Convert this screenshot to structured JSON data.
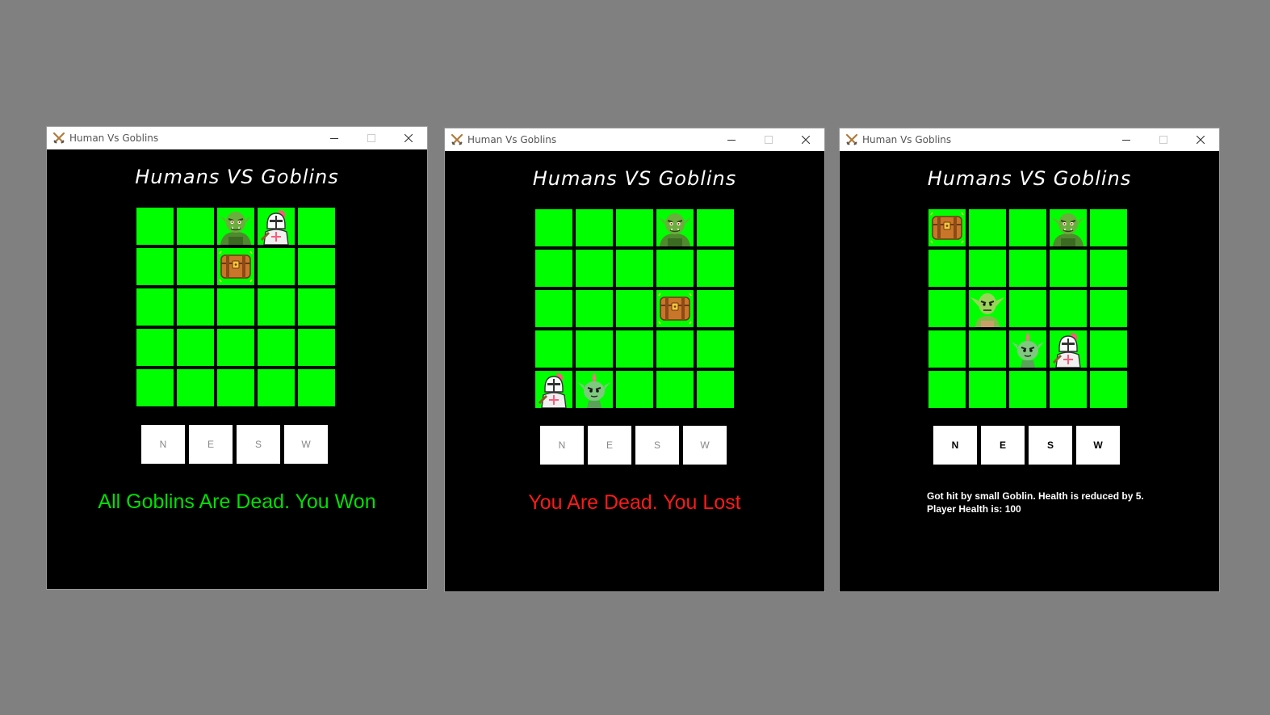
{
  "window_title": "Human Vs Goblins",
  "game_title": "Humans VS Goblins",
  "buttons": [
    "N",
    "E",
    "S",
    "W"
  ],
  "colors": {
    "cell": "#00ff00",
    "win": "#00e000",
    "lose": "#ff1a1a",
    "background": "#000000"
  },
  "windows": [
    {
      "message": "All Goblins Are Dead. You Won",
      "items": [
        {
          "row": 0,
          "col": 2,
          "type": "goblin-big"
        },
        {
          "row": 0,
          "col": 3,
          "type": "knight"
        },
        {
          "row": 1,
          "col": 2,
          "type": "chest"
        }
      ]
    },
    {
      "message": "You Are Dead. You Lost",
      "items": [
        {
          "row": 0,
          "col": 3,
          "type": "goblin-big"
        },
        {
          "row": 2,
          "col": 3,
          "type": "chest"
        },
        {
          "row": 4,
          "col": 0,
          "type": "knight"
        },
        {
          "row": 4,
          "col": 1,
          "type": "goblin-small"
        }
      ]
    },
    {
      "status_line1": "Got hit by small Goblin. Health is reduced by 5.",
      "status_line2": "Player Health is: 100",
      "items": [
        {
          "row": 0,
          "col": 0,
          "type": "chest"
        },
        {
          "row": 0,
          "col": 3,
          "type": "goblin-big"
        },
        {
          "row": 2,
          "col": 1,
          "type": "goblin-medium"
        },
        {
          "row": 3,
          "col": 2,
          "type": "goblin-small"
        },
        {
          "row": 3,
          "col": 3,
          "type": "knight"
        }
      ]
    }
  ]
}
